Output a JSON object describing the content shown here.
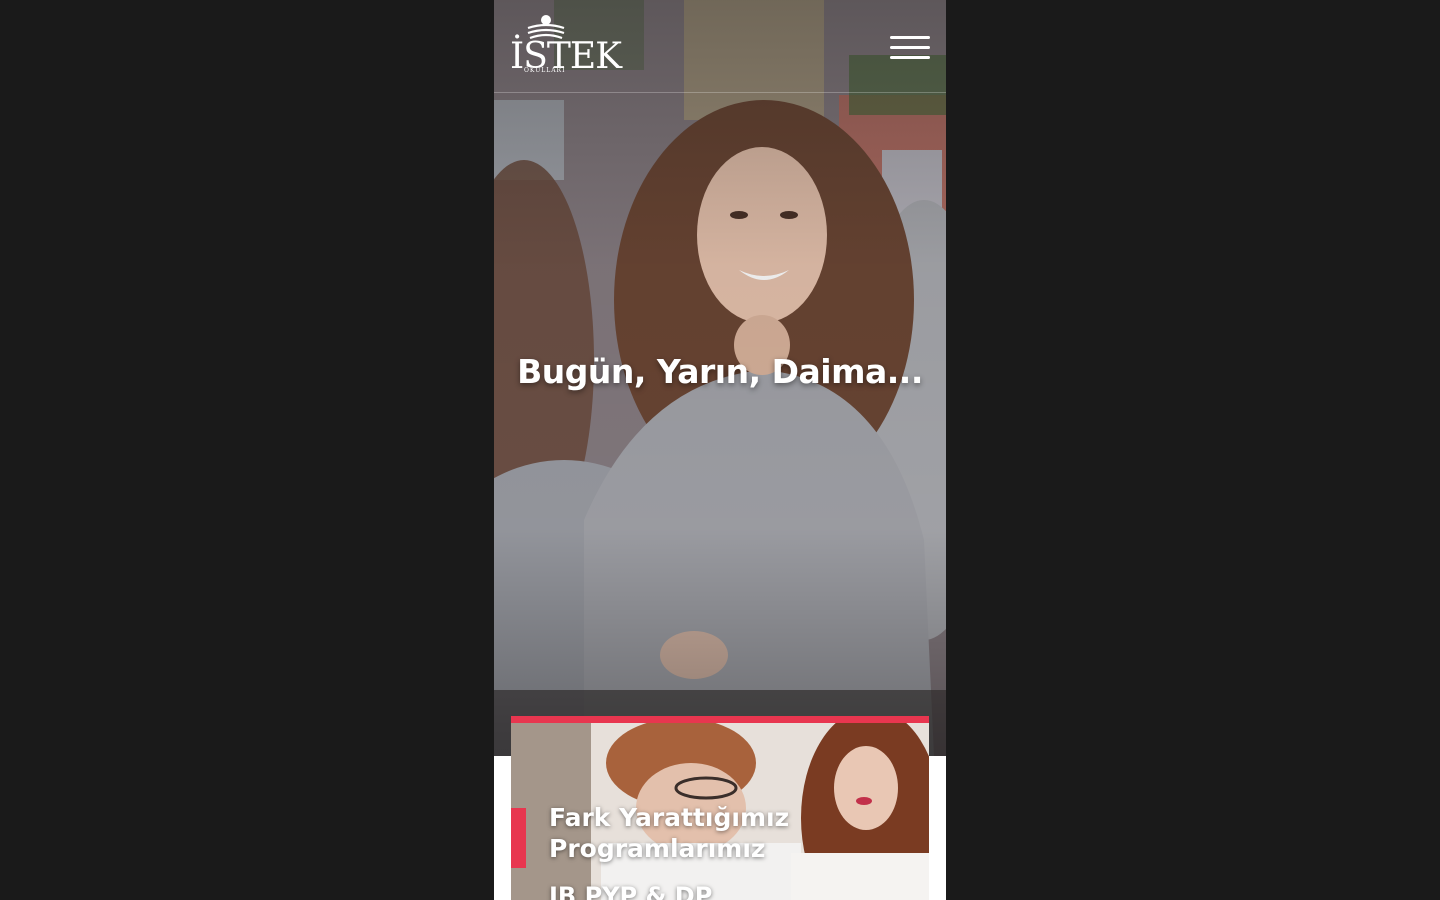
{
  "header": {
    "logo_text": "İSTEK",
    "logo_subtitle": "OKULLARI",
    "menu_icon": "hamburger-menu-icon"
  },
  "hero": {
    "headline": "Bugün, Yarın, Daima..."
  },
  "programs_card": {
    "title_line1": "Fark Yarattığımız",
    "title_line2": "Programlarımız",
    "subtitle": "IB PYP & DP"
  },
  "colors": {
    "accent": "#e8364f",
    "page_background": "#1a1a1a",
    "text_on_image": "#ffffff"
  }
}
